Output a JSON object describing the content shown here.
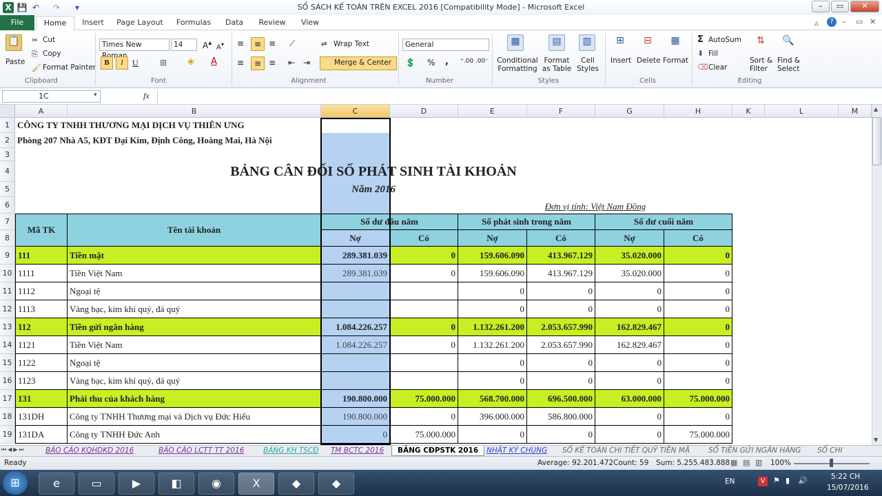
{
  "window": {
    "title": "SỔ SÁCH KẾ TOÁN TRÊN EXCEL 2016  [Compatibility Mode]  -  Microsoft Excel"
  },
  "ribbon": {
    "tabs": [
      "File",
      "Home",
      "Insert",
      "Page Layout",
      "Formulas",
      "Data",
      "Review",
      "View"
    ],
    "clipboard": {
      "paste": "Paste",
      "cut": "Cut",
      "copy": "Copy",
      "format_painter": "Format Painter",
      "label": "Clipboard"
    },
    "font": {
      "name": "Times New Roman",
      "size": "14",
      "label": "Font"
    },
    "alignment": {
      "wrap": "Wrap Text",
      "merge": "Merge & Center",
      "label": "Alignment"
    },
    "number": {
      "format": "General",
      "label": "Number",
      "percent": "%",
      "comma": ","
    },
    "styles": {
      "conditional": "Conditional\nFormatting",
      "format_table": "Format\nas Table",
      "cell_styles": "Cell\nStyles",
      "label": "Styles"
    },
    "cells": {
      "insert": "Insert",
      "delete": "Delete",
      "format": "Format",
      "label": "Cells"
    },
    "editing": {
      "autosum": "AutoSum",
      "fill": "Fill",
      "clear": "Clear",
      "sort": "Sort &\nFilter",
      "find": "Find &\nSelect",
      "label": "Editing"
    }
  },
  "formula_bar": {
    "name_box": "1C",
    "fx": "fx",
    "value": ""
  },
  "columns": [
    "A",
    "B",
    "C",
    "D",
    "E",
    "F",
    "G",
    "H",
    "K",
    "L",
    "M"
  ],
  "sheet": {
    "company": "CÔNG TY TNHH THƯƠNG MẠI DỊCH VỤ THIÊN ƯNG",
    "address": "Phòng 207 Nhà A5, KĐT Đại Kim, Định Công, Hoàng Mai, Hà Nội",
    "title": "BẢNG CÂN ĐỐI SỐ PHÁT SINH TÀI KHOẢN",
    "year": "Năm 2016",
    "unit": "Đơn vị tính: Việt Nam Đồng",
    "headers": {
      "code": "Mã TK",
      "name": "Tên tài khoản",
      "opening": "Số dư đầu năm",
      "movement": "Số phát sinh trong năm",
      "closing": "Số dư cuối năm",
      "debit": "Nợ",
      "credit": "Có"
    },
    "rows": [
      {
        "r": "9",
        "code": "111",
        "name": "Tiền mặt",
        "v": [
          "289.381.039",
          "0",
          "159.606.090",
          "413.967.129",
          "35.020.000",
          "0"
        ],
        "bold": true
      },
      {
        "r": "10",
        "code": "1111",
        "name": "Tiền Việt Nam",
        "v": [
          "289.381.039",
          "0",
          "159.606.090",
          "413.967.129",
          "35.020.000",
          "0"
        ]
      },
      {
        "r": "11",
        "code": "1112",
        "name": "Ngoại tệ",
        "v": [
          "",
          "",
          "0",
          "0",
          "0",
          "0"
        ]
      },
      {
        "r": "12",
        "code": "1113",
        "name": "Vàng bạc, kim khí quý, đá quý",
        "v": [
          "",
          "",
          "0",
          "0",
          "0",
          "0"
        ]
      },
      {
        "r": "13",
        "code": "112",
        "name": "Tiền gửi ngân hàng",
        "v": [
          "1.084.226.257",
          "0",
          "1.132.261.200",
          "2.053.657.990",
          "162.829.467",
          "0"
        ],
        "bold": true
      },
      {
        "r": "14",
        "code": "1121",
        "name": "Tiền Việt Nam",
        "v": [
          "1.084.226.257",
          "0",
          "1.132.261.200",
          "2.053.657.990",
          "162.829.467",
          "0"
        ]
      },
      {
        "r": "15",
        "code": "1122",
        "name": "Ngoại tệ",
        "v": [
          "",
          "",
          "0",
          "0",
          "0",
          "0"
        ]
      },
      {
        "r": "16",
        "code": "1123",
        "name": "Vàng bạc, kim khí quý, đá quý",
        "v": [
          "",
          "",
          "0",
          "0",
          "0",
          "0"
        ]
      },
      {
        "r": "17",
        "code": "131",
        "name": "Phải thu của khách hàng",
        "v": [
          "190.800.000",
          "75.000.000",
          "568.700.000",
          "696.500.000",
          "63.000.000",
          "75.000.000"
        ],
        "bold": true
      },
      {
        "r": "18",
        "code": "131DH",
        "name": "Công ty TNHH Thương mại và Dịch vụ Đức Hiếu",
        "v": [
          "190.800.000",
          "0",
          "396.000.000",
          "586.800.000",
          "0",
          "0"
        ]
      },
      {
        "r": "19",
        "code": "131DA",
        "name": "Công ty TNHH Đức Anh",
        "v": [
          "0",
          "75.000.000",
          "0",
          "0",
          "0",
          "75.000.000"
        ]
      }
    ]
  },
  "sheet_tabs": [
    "BÁO CÁO KQHDKD 2016",
    "BÁO CÁO LCTT TT 2016",
    "BẢNG KH TSCĐ",
    "TM BCTC 2016",
    "BẢNG CĐPSTK 2016",
    "NHẬT KÝ CHUNG",
    "SỔ KẾ TOÁN CHI TIẾT QUỸ TIỀN MẶ",
    "SỔ TIỀN GỬI NGÂN HÀNG",
    "SỔ CHI"
  ],
  "active_sheet": "BẢNG CĐPSTK 2016",
  "status": {
    "ready": "Ready",
    "average": "Average: 92.201.472",
    "count": "Count: 59",
    "sum": "Sum: 5.255.483.888",
    "zoom": "100%"
  },
  "taskbar": {
    "lang": "EN",
    "time": "5:22 CH",
    "date": "15/07/2016"
  }
}
